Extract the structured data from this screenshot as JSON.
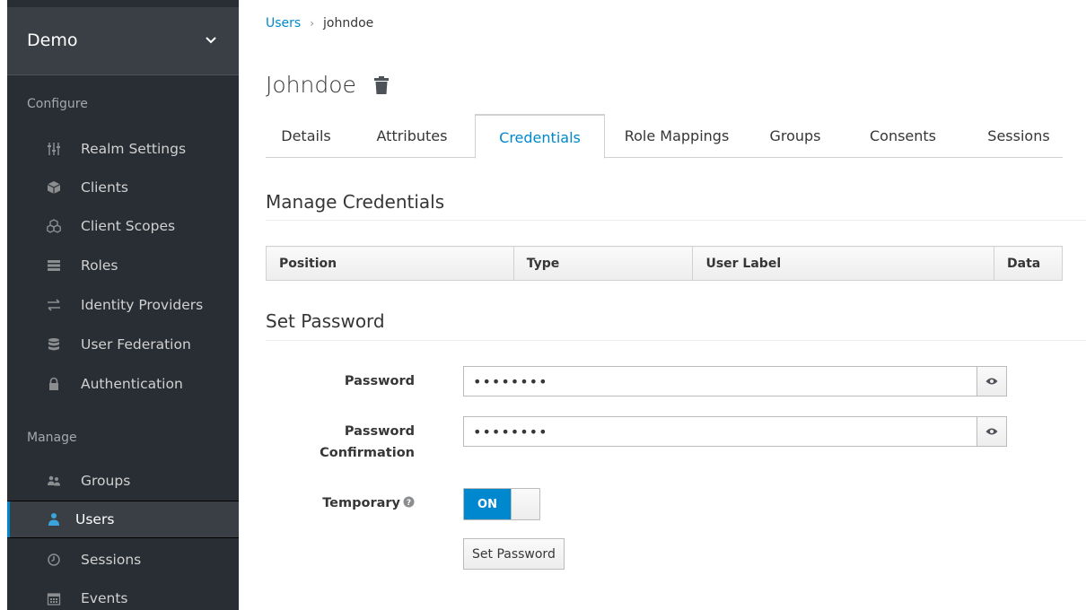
{
  "sidebar": {
    "realm": "Demo",
    "configure_title": "Configure",
    "manage_title": "Manage",
    "configure_items": [
      {
        "label": "Realm Settings",
        "icon": "sliders-icon"
      },
      {
        "label": "Clients",
        "icon": "cube-icon"
      },
      {
        "label": "Client Scopes",
        "icon": "cubes-icon"
      },
      {
        "label": "Roles",
        "icon": "roles-icon"
      },
      {
        "label": "Identity Providers",
        "icon": "exchange-icon"
      },
      {
        "label": "User Federation",
        "icon": "database-icon"
      },
      {
        "label": "Authentication",
        "icon": "lock-icon"
      }
    ],
    "manage_items": [
      {
        "label": "Groups",
        "icon": "users-icon"
      },
      {
        "label": "Users",
        "icon": "user-icon",
        "active": true
      },
      {
        "label": "Sessions",
        "icon": "clock-icon"
      },
      {
        "label": "Events",
        "icon": "calendar-icon"
      }
    ]
  },
  "breadcrumb": {
    "parent": "Users",
    "current": "johndoe"
  },
  "page": {
    "title": "Johndoe"
  },
  "tabs": [
    "Details",
    "Attributes",
    "Credentials",
    "Role Mappings",
    "Groups",
    "Consents",
    "Sessions"
  ],
  "active_tab": "Credentials",
  "manage_credentials": {
    "title": "Manage Credentials",
    "columns": [
      "Position",
      "Type",
      "User Label",
      "Data"
    ]
  },
  "set_password": {
    "title": "Set Password",
    "password_label": "Password",
    "password_value": "••••••••",
    "confirm_label_1": "Password",
    "confirm_label_2": "Confirmation",
    "confirm_value": "••••••••",
    "temporary_label": "Temporary",
    "toggle_state": "ON",
    "button_label": "Set Password"
  },
  "colors": {
    "accent": "#0088ce",
    "sidebar_bg": "#292e34"
  }
}
